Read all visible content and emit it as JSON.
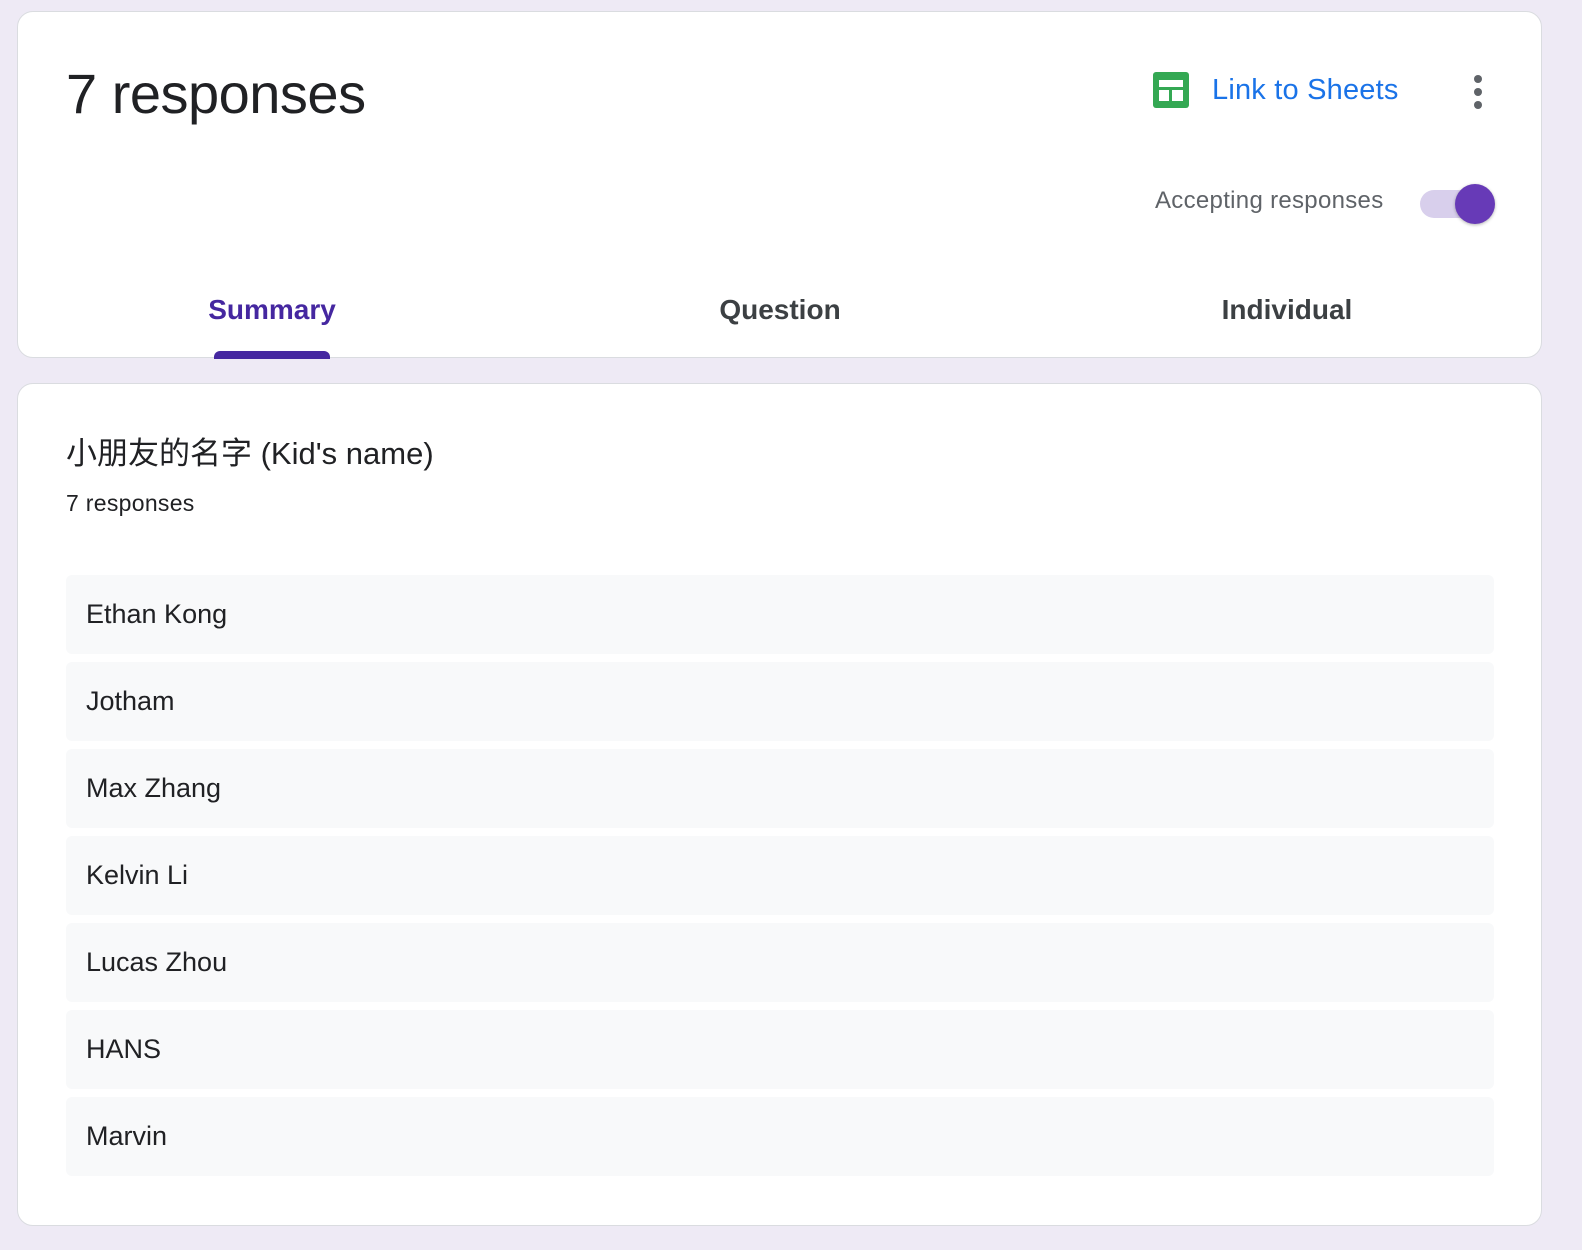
{
  "header": {
    "title": "7 responses",
    "link_to_sheets_label": "Link to Sheets",
    "accepting_label": "Accepting responses",
    "accepting_on": true,
    "sheets_icon_color": "#34a853",
    "accent_color": "#673ab7"
  },
  "tabs": [
    {
      "label": "Summary",
      "active": true
    },
    {
      "label": "Question",
      "active": false
    },
    {
      "label": "Individual",
      "active": false
    }
  ],
  "question": {
    "title": "小朋友的名字 (Kid's name)",
    "count": "7 responses",
    "responses": [
      "Ethan Kong",
      "Jotham",
      "Max Zhang",
      "Kelvin Li",
      "Lucas Zhou",
      "HANS",
      "Marvin"
    ]
  }
}
